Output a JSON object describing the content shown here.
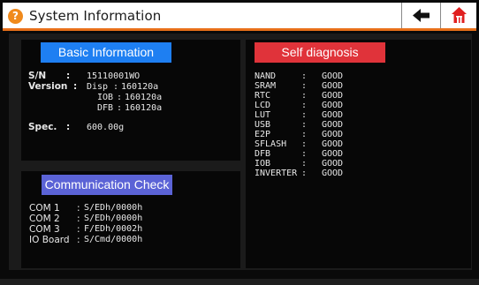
{
  "window": {
    "title": "System Information"
  },
  "basic_info": {
    "header": "Basic Information",
    "sn_label": "S/N",
    "sn_value": "15110001WO",
    "version_label": "Version",
    "disp_label": "Disp",
    "disp_value": "160120a",
    "iob_label": "IOB",
    "iob_value": "160120a",
    "dfb_label": "DFB",
    "dfb_value": "160120a",
    "spec_label": "Spec.",
    "spec_value": "600.00g"
  },
  "comm_check": {
    "header": "Communication Check",
    "rows": [
      {
        "label": "COM 1",
        "value": "S/EDh/0000h"
      },
      {
        "label": "COM 2",
        "value": "S/EDh/0000h"
      },
      {
        "label": "COM 3",
        "value": "F/EDh/0002h"
      },
      {
        "label": "IO Board",
        "value": "S/Cmd/0000h"
      }
    ]
  },
  "self_diag": {
    "header": "Self diagnosis",
    "rows": [
      {
        "label": "NAND",
        "value": "GOOD"
      },
      {
        "label": "SRAM",
        "value": "GOOD"
      },
      {
        "label": "RTC",
        "value": "GOOD"
      },
      {
        "label": "LCD",
        "value": "GOOD"
      },
      {
        "label": "LUT",
        "value": "GOOD"
      },
      {
        "label": "USB",
        "value": "GOOD"
      },
      {
        "label": "E2P",
        "value": "GOOD"
      },
      {
        "label": "SFLASH",
        "value": "GOOD"
      },
      {
        "label": "DFB",
        "value": "GOOD"
      },
      {
        "label": "IOB",
        "value": "GOOD"
      },
      {
        "label": "INVERTER",
        "value": "GOOD"
      }
    ]
  },
  "icons": {
    "help": "question-circle-icon",
    "back": "arrow-left-icon",
    "home": "home-icon"
  },
  "colors": {
    "accent_orange": "#e8701a",
    "basic_header": "#1e7ff2",
    "comm_header": "#5b63d6",
    "self_header": "#e0333a",
    "home_red": "#e02020"
  }
}
